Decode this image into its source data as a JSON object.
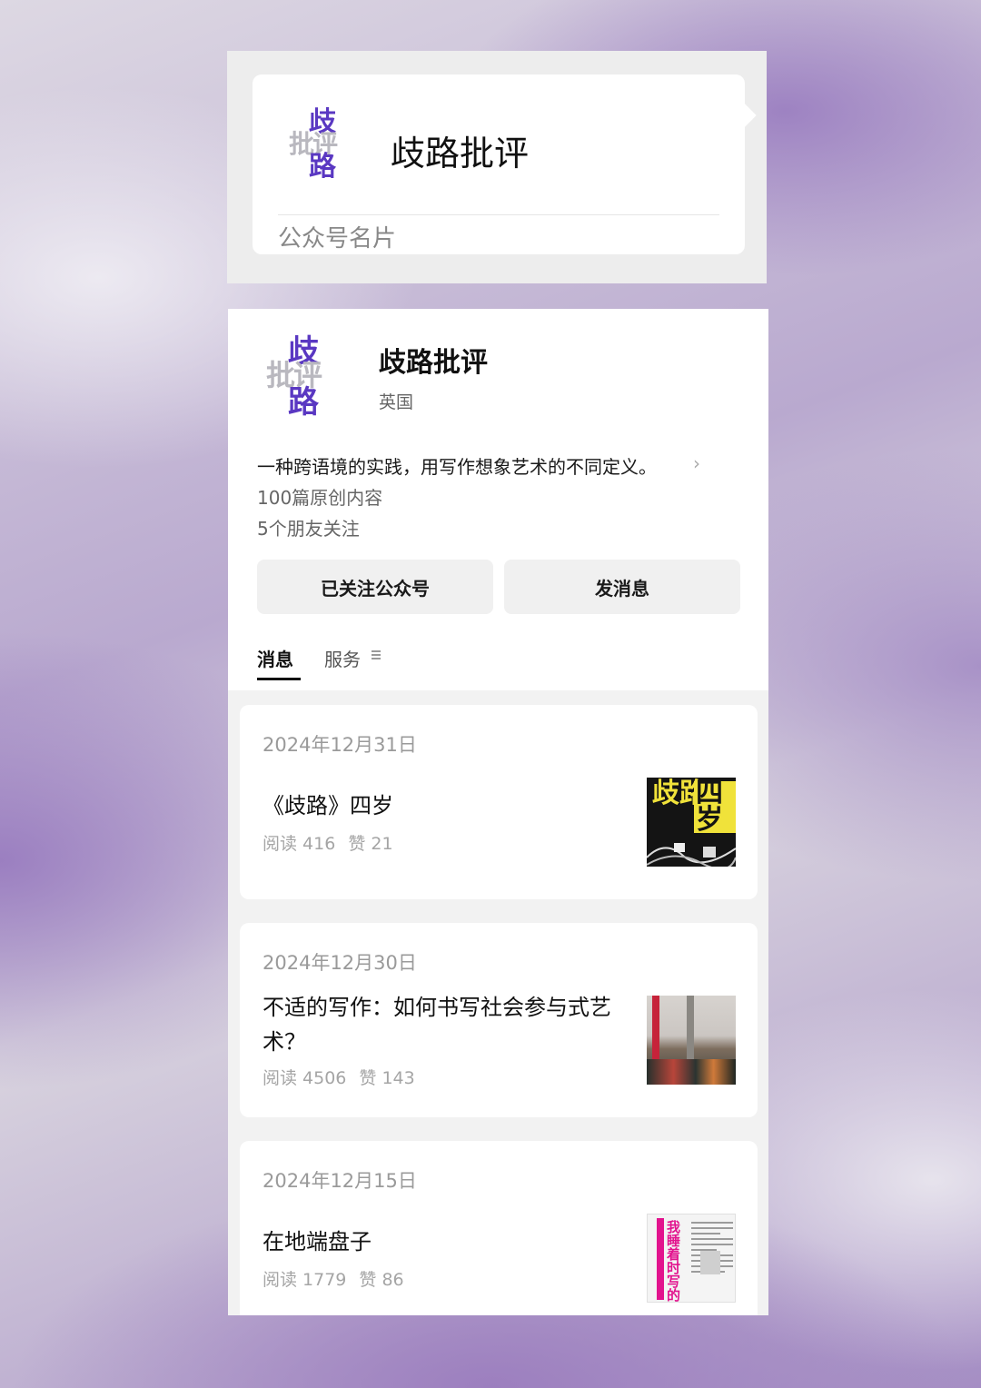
{
  "namecard": {
    "logo_chars": [
      "歧",
      "批评",
      "路"
    ],
    "name": "歧路批评",
    "caption": "公众号名片"
  },
  "profile": {
    "logo_chars": [
      "歧",
      "批评",
      "路"
    ],
    "name": "歧路批评",
    "region": "英国",
    "description": "一种跨语境的实践，用写作想象艺术的不同定义。",
    "original_count": "100篇原创内容",
    "friends_following": "5个朋友关注",
    "follow_button": "已关注公众号",
    "message_button": "发消息",
    "tabs": [
      {
        "label": "消息",
        "active": true
      },
      {
        "label": "服务",
        "active": false
      }
    ]
  },
  "messages": [
    {
      "date": "2024年12月31日",
      "title": "《歧路》四岁",
      "reads": "阅读 416",
      "likes": "赞 21",
      "thumb_text": [
        "歧路",
        "四岁"
      ]
    },
    {
      "date": "2024年12月30日",
      "title": "不适的写作：如何书写社会参与式艺术？",
      "reads": "阅读 4506",
      "likes": "赞 143"
    },
    {
      "date": "2024年12月15日",
      "title": "在地端盘子",
      "reads": "阅读 1779",
      "likes": "赞 86",
      "thumb_text": "我睡着时写的"
    }
  ],
  "colors": {
    "brand_purple": "#5a38c2",
    "card_bg": "#ffffff",
    "feed_bg": "#f2f2f2"
  }
}
